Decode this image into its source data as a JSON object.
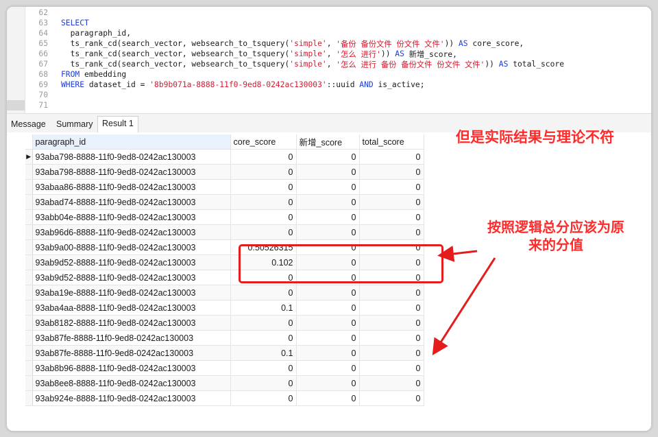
{
  "editor": {
    "lines": [
      {
        "n": "62",
        "segs": []
      },
      {
        "n": "63",
        "segs": [
          {
            "t": "SELECT",
            "c": "kw"
          }
        ]
      },
      {
        "n": "64",
        "segs": [
          {
            "t": "  paragraph_id,",
            "c": "code"
          }
        ]
      },
      {
        "n": "65",
        "segs": [
          {
            "t": "  ts_rank_cd(search_vector, websearch_to_tsquery(",
            "c": "code"
          },
          {
            "t": "'simple'",
            "c": "str"
          },
          {
            "t": ", ",
            "c": "code"
          },
          {
            "t": "'备份 备份文件 份文件 文件'",
            "c": "str"
          },
          {
            "t": ")) ",
            "c": "code"
          },
          {
            "t": "AS",
            "c": "kw"
          },
          {
            "t": " core_score,",
            "c": "code"
          }
        ]
      },
      {
        "n": "66",
        "segs": [
          {
            "t": "  ts_rank_cd(search_vector, websearch_to_tsquery(",
            "c": "code"
          },
          {
            "t": "'simple'",
            "c": "str"
          },
          {
            "t": ", ",
            "c": "code"
          },
          {
            "t": "'怎么 进行'",
            "c": "str"
          },
          {
            "t": ")) ",
            "c": "code"
          },
          {
            "t": "AS",
            "c": "kw"
          },
          {
            "t": " 新增_score,",
            "c": "code"
          }
        ]
      },
      {
        "n": "67",
        "segs": [
          {
            "t": "  ts_rank_cd(search_vector, websearch_to_tsquery(",
            "c": "code"
          },
          {
            "t": "'simple'",
            "c": "str"
          },
          {
            "t": ", ",
            "c": "code"
          },
          {
            "t": "'怎么 进行 备份 备份文件 份文件 文件'",
            "c": "str"
          },
          {
            "t": ")) ",
            "c": "code"
          },
          {
            "t": "AS",
            "c": "kw"
          },
          {
            "t": " total_score",
            "c": "code"
          }
        ]
      },
      {
        "n": "68",
        "segs": [
          {
            "t": "FROM",
            "c": "kw"
          },
          {
            "t": " embedding",
            "c": "code"
          }
        ]
      },
      {
        "n": "69",
        "segs": [
          {
            "t": "WHERE",
            "c": "kw"
          },
          {
            "t": " dataset_id = ",
            "c": "code"
          },
          {
            "t": "'8b9b071a-8888-11f0-9ed8-0242ac130003'",
            "c": "str"
          },
          {
            "t": "::uuid ",
            "c": "code"
          },
          {
            "t": "AND",
            "c": "kw"
          },
          {
            "t": " is_active;",
            "c": "code"
          }
        ]
      },
      {
        "n": "70",
        "segs": []
      },
      {
        "n": "71",
        "segs": []
      }
    ]
  },
  "tabs": [
    "Message",
    "Summary",
    "Result 1"
  ],
  "active_tab": "Result 1",
  "result": {
    "columns": [
      "paragraph_id",
      "core_score",
      "新增_score",
      "total_score"
    ],
    "rows": [
      [
        "93aba798-8888-11f0-9ed8-0242ac130003",
        "0",
        "0",
        "0"
      ],
      [
        "93aba798-8888-11f0-9ed8-0242ac130003",
        "0",
        "0",
        "0"
      ],
      [
        "93abaa86-8888-11f0-9ed8-0242ac130003",
        "0",
        "0",
        "0"
      ],
      [
        "93abad74-8888-11f0-9ed8-0242ac130003",
        "0",
        "0",
        "0"
      ],
      [
        "93abb04e-8888-11f0-9ed8-0242ac130003",
        "0",
        "0",
        "0"
      ],
      [
        "93ab96d6-8888-11f0-9ed8-0242ac130003",
        "0",
        "0",
        "0"
      ],
      [
        "93ab9a00-8888-11f0-9ed8-0242ac130003",
        "0.50526315",
        "0",
        "0"
      ],
      [
        "93ab9d52-8888-11f0-9ed8-0242ac130003",
        "0.102",
        "0",
        "0"
      ],
      [
        "93ab9d52-8888-11f0-9ed8-0242ac130003",
        "0",
        "0",
        "0"
      ],
      [
        "93aba19e-8888-11f0-9ed8-0242ac130003",
        "0",
        "0",
        "0"
      ],
      [
        "93aba4aa-8888-11f0-9ed8-0242ac130003",
        "0.1",
        "0",
        "0"
      ],
      [
        "93ab8182-8888-11f0-9ed8-0242ac130003",
        "0",
        "0",
        "0"
      ],
      [
        "93ab87fe-8888-11f0-9ed8-0242ac130003",
        "0",
        "0",
        "0"
      ],
      [
        "93ab87fe-8888-11f0-9ed8-0242ac130003",
        "0.1",
        "0",
        "0"
      ],
      [
        "93ab8b96-8888-11f0-9ed8-0242ac130003",
        "0",
        "0",
        "0"
      ],
      [
        "93ab8ee8-8888-11f0-9ed8-0242ac130003",
        "0",
        "0",
        "0"
      ],
      [
        "93ab924e-8888-11f0-9ed8-0242ac130003",
        "0",
        "0",
        "0"
      ]
    ]
  },
  "annotations": {
    "note1": "但是实际结果与理论不符",
    "note2_line1": "按照逻辑总分应该为原",
    "note2_line2": "来的分值",
    "color": "#ff2b2b"
  }
}
